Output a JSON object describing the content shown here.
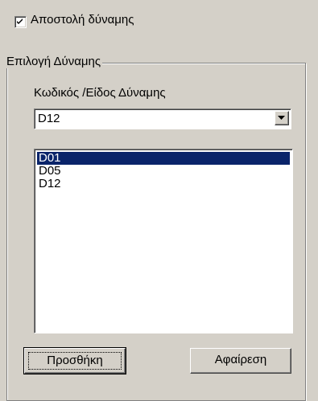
{
  "send_force": {
    "label": "Αποστολή δύναμης",
    "checked": true
  },
  "group": {
    "title": "Επιλογή Δύναμης",
    "field_label": "Κωδικός /Είδος Δύναμης",
    "combo": {
      "value": "D12",
      "icon": "chevron-down-icon"
    },
    "list": {
      "items": [
        "D01",
        "D05",
        "D12"
      ],
      "selected_index": 0
    }
  },
  "buttons": {
    "add_label": "Προσθήκη",
    "remove_label": "Αφαίρεση"
  },
  "colors": {
    "face": "#d4d0c8",
    "selection": "#0a246a"
  }
}
